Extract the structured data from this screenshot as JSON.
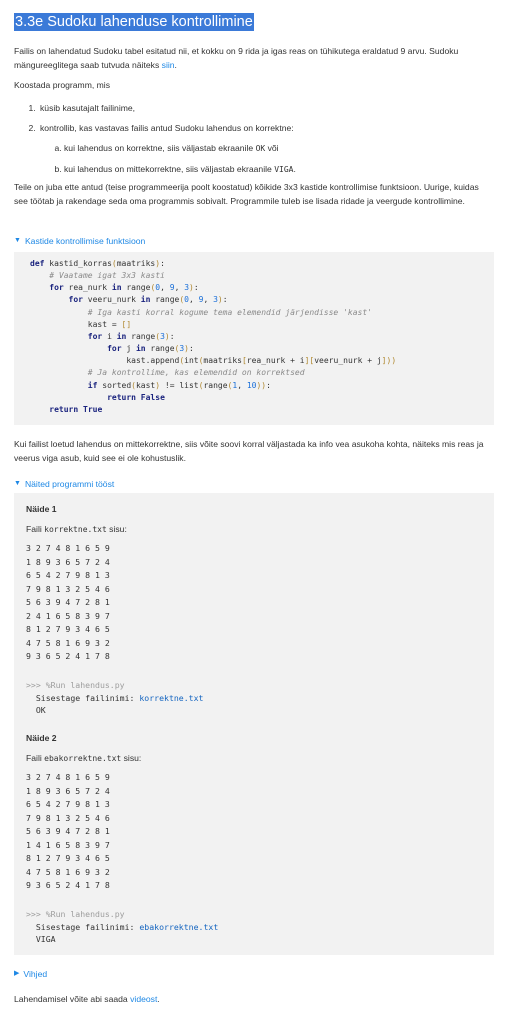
{
  "title": "3.3e Sudoku lahenduse kontrollimine",
  "intro": {
    "text1": "Failis on lahendatud Sudoku tabel esitatud nii, et kokku on 9 rida ja igas reas on tühikutega eraldatud 9 arvu. Sudoku mängureeglitega saab tutvuda näiteks ",
    "link": "siin",
    "text2": "."
  },
  "task_intro": "Koostada programm, mis",
  "steps": [
    "küsib kasutajalt failinime,",
    "kontrollib, kas vastavas failis antud Sudoku lahendus on korrektne:"
  ],
  "substeps": [
    {
      "before": "kui lahendus on korrektne, siis väljastab ekraanile ",
      "code": "OK",
      "after": " või"
    },
    {
      "before": "kui lahendus on mittekorrektne, siis väljastab ekraanile ",
      "code": "VIGA",
      "after": "."
    }
  ],
  "helper_text": "Teile on juba ette antud (teise programmeerija poolt koostatud) kõikide 3x3 kastide kontrollimise funktsioon. Uurige, kuidas see töötab ja rakendage seda oma programmis sobivalt. Programmile tuleb ise lisada ridade ja veergude kontrollimine.",
  "details_function": {
    "summary": "Kastide kontrollimise funktsioon",
    "code_lines": [
      "def kastid_korras(maatriks):",
      "    # Vaatame igat 3x3 kasti",
      "    for rea_nurk in range(0, 9, 3):",
      "        for veeru_nurk in range(0, 9, 3):",
      "            # Iga kasti korral kogume tema elemendid järjendisse 'kast'",
      "            kast = []",
      "            for i in range(3):",
      "                for j in range(3):",
      "                    kast.append(int(maatriks[rea_nurk + i][veeru_nurk + j]))",
      "            # Ja kontrollime, kas elemendid on korrektsed",
      "            if sorted(kast) != list(range(1, 10)):",
      "                return False",
      "    return True"
    ]
  },
  "optional_text": "Kui failist loetud lahendus on mittekorrektne, siis võite soovi korral väljastada ka info vea asukoha kohta, näiteks mis reas ja veerus viga asub, kuid see ei ole kohustuslik.",
  "details_examples": {
    "summary": "Näited programmi tööst",
    "examples": [
      {
        "heading": "Näide 1",
        "file_label_before": "Faili ",
        "file_name": "korrektne.txt",
        "file_label_after": " sisu:",
        "grid": [
          "3 2 7 4 8 1 6 5 9",
          "1 8 9 3 6 5 7 2 4",
          "6 5 4 2 7 9 8 1 3",
          "7 9 8 1 3 2 5 4 6",
          "5 6 3 9 4 7 2 8 1",
          "2 4 1 6 5 8 3 9 7",
          "8 1 2 7 9 3 4 6 5",
          "4 7 5 8 1 6 9 3 2",
          "9 3 6 5 2 4 1 7 8"
        ],
        "run_cmd": ">>> %Run lahendus.py",
        "run_prompt": "  Sisestage failinimi: ",
        "run_input": "korrektne.txt",
        "run_output": "  OK"
      },
      {
        "heading": "Näide 2",
        "file_label_before": "Faili ",
        "file_name": "ebakorrektne.txt",
        "file_label_after": " sisu:",
        "grid": [
          "3 2 7 4 8 1 6 5 9",
          "1 8 9 3 6 5 7 2 4",
          "6 5 4 2 7 9 8 1 3",
          "7 9 8 1 3 2 5 4 6",
          "5 6 3 9 4 7 2 8 1",
          "1 4 1 6 5 8 3 9 7",
          "8 1 2 7 9 3 4 6 5",
          "4 7 5 8 1 6 9 3 2",
          "9 3 6 5 2 4 1 7 8"
        ],
        "run_cmd": ">>> %Run lahendus.py",
        "run_prompt": "  Sisestage failinimi: ",
        "run_input": "ebakorrektne.txt",
        "run_output": "  VIGA"
      }
    ]
  },
  "details_hints": {
    "summary": "Vihjed"
  },
  "footer": {
    "text": "Lahendamisel võite abi saada ",
    "link": "videost",
    "after": "."
  },
  "colors": {
    "link": "#1e88e5",
    "title_highlight": "#3b7ad8",
    "code_bg": "#f2f2f2"
  }
}
